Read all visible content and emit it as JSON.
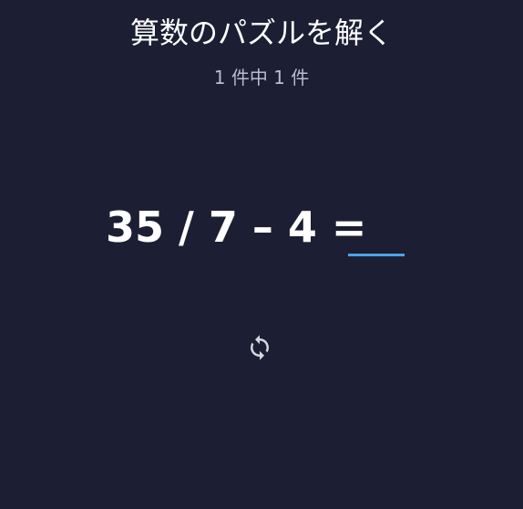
{
  "header": {
    "title": "算数のパズルを解く",
    "counter": "1 件中 1 件"
  },
  "puzzle": {
    "expression": "35 / 7 – 4 =",
    "answer_value": "",
    "answer_color": "#4fa3e6"
  },
  "controls": {
    "refresh_icon": "refresh-icon"
  },
  "colors": {
    "background": "#1c1f33",
    "text": "#ffffff",
    "muted": "#b9bccb",
    "accent": "#4fa3e6"
  }
}
